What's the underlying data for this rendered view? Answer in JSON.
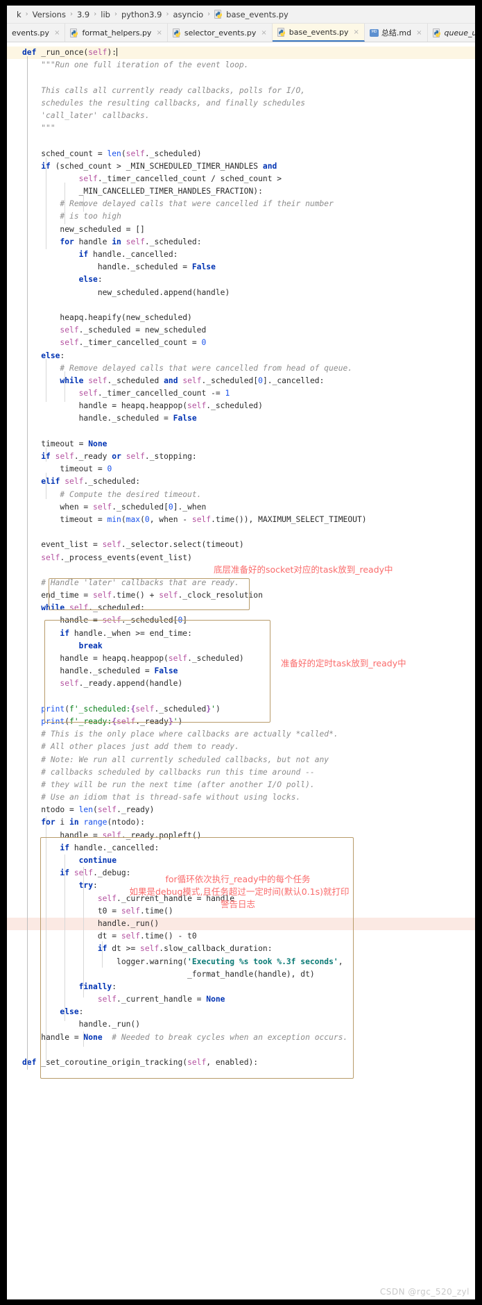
{
  "window": {
    "breadcrumb": {
      "items": [
        "k",
        "Versions",
        "3.9",
        "lib",
        "python3.9",
        "asyncio",
        "base_events.py"
      ],
      "separator": "›",
      "file_icon": "python-file-icon"
    },
    "tabs": [
      {
        "label": "events.py",
        "icon": "python-file-icon",
        "active": false,
        "italic": false,
        "close": "×"
      },
      {
        "label": "format_helpers.py",
        "icon": "python-file-icon",
        "active": false,
        "italic": false,
        "close": "×"
      },
      {
        "label": "selector_events.py",
        "icon": "python-file-icon",
        "active": false,
        "italic": false,
        "close": "×"
      },
      {
        "label": "base_events.py",
        "icon": "python-file-icon",
        "active": true,
        "italic": false,
        "close": "×"
      },
      {
        "label": "总结.md",
        "icon": "markdown-file-icon",
        "active": false,
        "italic": false,
        "close": "×"
      },
      {
        "label": "queue_us",
        "icon": "python-file-icon",
        "active": false,
        "italic": true,
        "close": ""
      }
    ]
  },
  "annotations": [
    {
      "text": "底层准备好的socket对应的task放到_ready中"
    },
    {
      "text": "准备好的定时task放到_ready中"
    },
    {
      "text": "for循环依次执行_ready中的每个任务"
    },
    {
      "text": "如果是debug模式,且任务超过一定时间(默认0.1s)就打印"
    },
    {
      "text": "警告日志"
    }
  ],
  "watermark": "CSDN @rgc_520_zyl",
  "colors": {
    "keyword": "#0033b3",
    "self": "#b452a0",
    "builtin": "#1750eb",
    "comment": "#8c8c8c",
    "string": "#067d17",
    "annotation_red": "#fa6b6b",
    "annotation_box": "#b89b6a",
    "active_tab_bg": "#fdf8e6",
    "active_tab_underline": "#3b77c2",
    "caret_line_bg": "#fdf6e3",
    "exec_line_bg": "#fbe9e3"
  },
  "code_lines": [
    {
      "i": 0,
      "hl": "caret",
      "html": "<span class=\"kw\">def</span> _run_once(<span class=\"self\">self</span>):<span class=\"caret\"></span>"
    },
    {
      "i": 1,
      "hl": "",
      "html": "    <span class=\"cm\">\"\"\"Run one full iteration of the event loop.</span>"
    },
    {
      "i": 2,
      "hl": "",
      "html": ""
    },
    {
      "i": 3,
      "hl": "",
      "html": "    <span class=\"cm\">This calls all currently ready callbacks, polls for I/O,</span>"
    },
    {
      "i": 4,
      "hl": "",
      "html": "    <span class=\"cm\">schedules the resulting callbacks, and finally schedules</span>"
    },
    {
      "i": 5,
      "hl": "",
      "html": "    <span class=\"cm\">'call_later' callbacks.</span>"
    },
    {
      "i": 6,
      "hl": "",
      "html": "    <span class=\"cm\">\"\"\"</span>"
    },
    {
      "i": 7,
      "hl": "",
      "html": ""
    },
    {
      "i": 8,
      "hl": "",
      "html": "    sched_count = <span class=\"bi\">len</span>(<span class=\"self\">self</span>._scheduled)"
    },
    {
      "i": 9,
      "hl": "",
      "html": "    <span class=\"kw\">if</span> (sched_count &gt; _MIN_SCHEDULED_TIMER_HANDLES <span class=\"kw\">and</span>"
    },
    {
      "i": 10,
      "hl": "",
      "html": "            <span class=\"self\">self</span>._timer_cancelled_count / sched_count &gt;"
    },
    {
      "i": 11,
      "hl": "",
      "html": "            _MIN_CANCELLED_TIMER_HANDLES_FRACTION):"
    },
    {
      "i": 12,
      "hl": "",
      "html": "        <span class=\"cm\"># Remove delayed calls that were cancelled if their number</span>"
    },
    {
      "i": 13,
      "hl": "",
      "html": "        <span class=\"cm\"># is too high</span>"
    },
    {
      "i": 14,
      "hl": "",
      "html": "        new_scheduled = []"
    },
    {
      "i": 15,
      "hl": "",
      "html": "        <span class=\"kw\">for</span> handle <span class=\"kw\">in</span> <span class=\"self\">self</span>._scheduled:"
    },
    {
      "i": 16,
      "hl": "",
      "html": "            <span class=\"kw\">if</span> handle._cancelled:"
    },
    {
      "i": 17,
      "hl": "",
      "html": "                handle._scheduled = <span class=\"cons\">False</span>"
    },
    {
      "i": 18,
      "hl": "",
      "html": "            <span class=\"kw\">else</span>:"
    },
    {
      "i": 19,
      "hl": "",
      "html": "                new_scheduled.append(handle)"
    },
    {
      "i": 20,
      "hl": "",
      "html": ""
    },
    {
      "i": 21,
      "hl": "",
      "html": "        heapq.heapify(new_scheduled)"
    },
    {
      "i": 22,
      "hl": "",
      "html": "        <span class=\"self\">self</span>._scheduled = new_scheduled"
    },
    {
      "i": 23,
      "hl": "",
      "html": "        <span class=\"self\">self</span>._timer_cancelled_count = <span class=\"num\">0</span>"
    },
    {
      "i": 24,
      "hl": "",
      "html": "    <span class=\"kw\">else</span>:"
    },
    {
      "i": 25,
      "hl": "",
      "html": "        <span class=\"cm\"># Remove delayed calls that were cancelled from head of queue.</span>"
    },
    {
      "i": 26,
      "hl": "",
      "html": "        <span class=\"kw\">while</span> <span class=\"self\">self</span>._scheduled <span class=\"kw\">and</span> <span class=\"self\">self</span>._scheduled[<span class=\"num\">0</span>]._cancelled:"
    },
    {
      "i": 27,
      "hl": "",
      "html": "            <span class=\"self\">self</span>._timer_cancelled_count -= <span class=\"num\">1</span>"
    },
    {
      "i": 28,
      "hl": "",
      "html": "            handle = heapq.heappop(<span class=\"self\">self</span>._scheduled)"
    },
    {
      "i": 29,
      "hl": "",
      "html": "            handle._scheduled = <span class=\"cons\">False</span>"
    },
    {
      "i": 30,
      "hl": "",
      "html": ""
    },
    {
      "i": 31,
      "hl": "",
      "html": "    timeout = <span class=\"cons\">None</span>"
    },
    {
      "i": 32,
      "hl": "",
      "html": "    <span class=\"kw\">if</span> <span class=\"self\">self</span>._ready <span class=\"kw\">or</span> <span class=\"self\">self</span>._stopping:"
    },
    {
      "i": 33,
      "hl": "",
      "html": "        timeout = <span class=\"num\">0</span>"
    },
    {
      "i": 34,
      "hl": "",
      "html": "    <span class=\"kw\">elif</span> <span class=\"self\">self</span>._scheduled:"
    },
    {
      "i": 35,
      "hl": "",
      "html": "        <span class=\"cm\"># Compute the desired timeout.</span>"
    },
    {
      "i": 36,
      "hl": "",
      "html": "        when = <span class=\"self\">self</span>._scheduled[<span class=\"num\">0</span>]._when"
    },
    {
      "i": 37,
      "hl": "",
      "html": "        timeout = <span class=\"bi\">min</span>(<span class=\"bi\">max</span>(<span class=\"num\">0</span>, when - <span class=\"self\">self</span>.time()), MAXIMUM_SELECT_TIMEOUT)"
    },
    {
      "i": 38,
      "hl": "",
      "html": ""
    },
    {
      "i": 39,
      "hl": "",
      "html": "    event_list = <span class=\"self\">self</span>._selector.select(timeout)"
    },
    {
      "i": 40,
      "hl": "",
      "html": "    <span class=\"self\">self</span>._process_events(event_list)"
    },
    {
      "i": 41,
      "hl": "",
      "html": ""
    },
    {
      "i": 42,
      "hl": "",
      "html": "    <span class=\"cm\"># Handle 'later' callbacks that are ready.</span>"
    },
    {
      "i": 43,
      "hl": "",
      "html": "    end_time = <span class=\"self\">self</span>.time() + <span class=\"self\">self</span>._clock_resolution"
    },
    {
      "i": 44,
      "hl": "",
      "html": "    <span class=\"kw\">while</span> <span class=\"self\">self</span>._scheduled:"
    },
    {
      "i": 45,
      "hl": "",
      "html": "        handle = <span class=\"self\">self</span>._scheduled[<span class=\"num\">0</span>]"
    },
    {
      "i": 46,
      "hl": "",
      "html": "        <span class=\"kw\">if</span> handle._when &gt;= end_time:"
    },
    {
      "i": 47,
      "hl": "",
      "html": "            <span class=\"kw\">break</span>"
    },
    {
      "i": 48,
      "hl": "",
      "html": "        handle = heapq.heappop(<span class=\"self\">self</span>._scheduled)"
    },
    {
      "i": 49,
      "hl": "",
      "html": "        handle._scheduled = <span class=\"cons\">False</span>"
    },
    {
      "i": 50,
      "hl": "",
      "html": "        <span class=\"self\">self</span>._ready.append(handle)"
    },
    {
      "i": 51,
      "hl": "",
      "html": ""
    },
    {
      "i": 52,
      "hl": "",
      "html": "    <span class=\"bi\">print</span>(<span class=\"fstr\">f'_scheduled:</span><span class=\"brace\">{</span><span class=\"self\">self</span>._scheduled<span class=\"brace\">}</span><span class=\"fstr\">'</span>)"
    },
    {
      "i": 53,
      "hl": "",
      "html": "    <span class=\"bi\">print</span>(<span class=\"fstr\">f'_ready:</span><span class=\"brace\">{</span><span class=\"self\">self</span>._ready<span class=\"brace\">}</span><span class=\"fstr\">'</span>)"
    },
    {
      "i": 54,
      "hl": "",
      "html": "    <span class=\"cm\"># This is the only place where callbacks are actually *called*.</span>"
    },
    {
      "i": 55,
      "hl": "",
      "html": "    <span class=\"cm\"># All other places just add them to ready.</span>"
    },
    {
      "i": 56,
      "hl": "",
      "html": "    <span class=\"cm\"># Note: We run all currently scheduled callbacks, but not any</span>"
    },
    {
      "i": 57,
      "hl": "",
      "html": "    <span class=\"cm\"># callbacks scheduled by callbacks run this time around --</span>"
    },
    {
      "i": 58,
      "hl": "",
      "html": "    <span class=\"cm\"># they will be run the next time (after another I/O poll).</span>"
    },
    {
      "i": 59,
      "hl": "",
      "html": "    <span class=\"cm\"># Use an idiom that is thread-safe without using locks.</span>"
    },
    {
      "i": 60,
      "hl": "",
      "html": "    ntodo = <span class=\"bi\">len</span>(<span class=\"self\">self</span>._ready)"
    },
    {
      "i": 61,
      "hl": "",
      "html": "    <span class=\"kw\">for</span> i <span class=\"kw\">in</span> <span class=\"bi\">range</span>(ntodo):"
    },
    {
      "i": 62,
      "hl": "",
      "html": "        handle = <span class=\"self\">self</span>._ready.popleft()"
    },
    {
      "i": 63,
      "hl": "",
      "html": "        <span class=\"kw\">if</span> handle._cancelled:"
    },
    {
      "i": 64,
      "hl": "",
      "html": "            <span class=\"kw\">continue</span>"
    },
    {
      "i": 65,
      "hl": "",
      "html": "        <span class=\"kw\">if</span> <span class=\"self\">self</span>._debug:"
    },
    {
      "i": 66,
      "hl": "",
      "html": "            <span class=\"kw\">try</span>:"
    },
    {
      "i": 67,
      "hl": "",
      "html": "                <span class=\"self\">self</span>._current_handle = handle"
    },
    {
      "i": 68,
      "hl": "",
      "html": "                t0 = <span class=\"self\">self</span>.time()"
    },
    {
      "i": 69,
      "hl": "exec",
      "html": "                handle._run()"
    },
    {
      "i": 70,
      "hl": "",
      "html": "                dt = <span class=\"self\">self</span>.time() - t0"
    },
    {
      "i": 71,
      "hl": "",
      "html": "                <span class=\"kw\">if</span> dt &gt;= <span class=\"self\">self</span>.slow_callback_duration:"
    },
    {
      "i": 72,
      "hl": "",
      "html": "                    logger.warning(<span class=\"tealstr\">'Executing %s took %.3f seconds'</span>,"
    },
    {
      "i": 73,
      "hl": "",
      "html": "                                   _format_handle(handle), dt)"
    },
    {
      "i": 74,
      "hl": "",
      "html": "            <span class=\"kw\">finally</span>:"
    },
    {
      "i": 75,
      "hl": "",
      "html": "                <span class=\"self\">self</span>._current_handle = <span class=\"cons\">None</span>"
    },
    {
      "i": 76,
      "hl": "",
      "html": "        <span class=\"kw\">else</span>:"
    },
    {
      "i": 77,
      "hl": "",
      "html": "            handle._run()"
    },
    {
      "i": 78,
      "hl": "",
      "html": "    handle = <span class=\"cons\">None</span>  <span class=\"cm\"># Needed to break cycles when an exception occurs.</span>"
    },
    {
      "i": 79,
      "hl": "",
      "html": ""
    },
    {
      "i": 80,
      "hl": "",
      "html": "<span class=\"kw\">def</span> _set_coroutine_origin_tracking(<span class=\"self\">self</span>, enabled):"
    }
  ]
}
